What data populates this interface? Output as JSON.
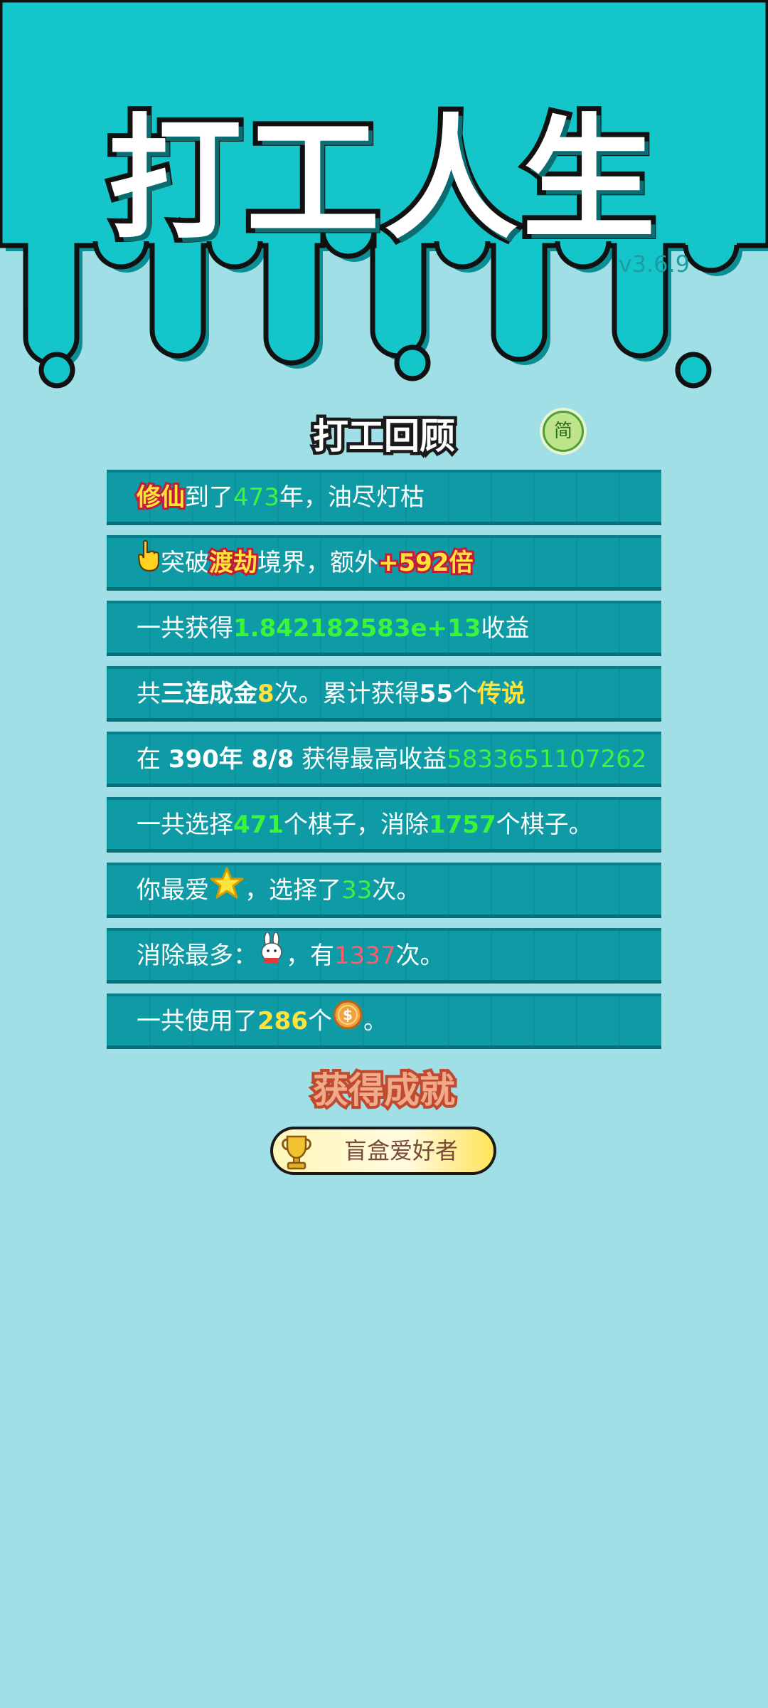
{
  "app": {
    "title": "打工人生",
    "version": "v3.6.9"
  },
  "review": {
    "title": "打工回顾",
    "lang_toggle": "简",
    "rows": [
      {
        "parts": [
          {
            "t": "修仙",
            "s": "hl"
          },
          {
            "t": "到了"
          },
          {
            "t": "473",
            "s": "g"
          },
          {
            "t": "年，油尽灯枯"
          }
        ]
      },
      {
        "icon": "hand-pointer-icon",
        "parts": [
          {
            "t": "突破"
          },
          {
            "t": "渡劫",
            "s": "hl"
          },
          {
            "t": "境界，额外"
          },
          {
            "t": "+592倍",
            "s": "hl"
          }
        ]
      },
      {
        "parts": [
          {
            "t": "一共获得"
          },
          {
            "t": "1.842182583e+13",
            "s": "g b"
          },
          {
            "t": "收益"
          }
        ]
      },
      {
        "parts": [
          {
            "t": "共"
          },
          {
            "t": "三连成金",
            "s": "b"
          },
          {
            "t": "8",
            "s": "y b"
          },
          {
            "t": "次。累计获得"
          },
          {
            "t": "55",
            "s": "b"
          },
          {
            "t": "个"
          },
          {
            "t": "传说",
            "s": "y b"
          }
        ]
      },
      {
        "parts": [
          {
            "t": "在 "
          },
          {
            "t": "390年 8/8",
            "s": "b"
          },
          {
            "t": " 获得最高收益"
          },
          {
            "t": "5833651107262",
            "s": "g"
          }
        ]
      },
      {
        "parts": [
          {
            "t": "一共选择"
          },
          {
            "t": "471",
            "s": "g b"
          },
          {
            "t": "个棋子，消除"
          },
          {
            "t": "1757",
            "s": "g b"
          },
          {
            "t": "个棋子。"
          }
        ]
      },
      {
        "parts": [
          {
            "t": "你最爱"
          },
          {
            "icon": "star-icon"
          },
          {
            "t": "，选择了"
          },
          {
            "t": "33",
            "s": "g"
          },
          {
            "t": "次。"
          }
        ]
      },
      {
        "parts": [
          {
            "t": "消除最多："
          },
          {
            "icon": "rabbit-icon"
          },
          {
            "t": "，有"
          },
          {
            "t": "1337",
            "s": "r"
          },
          {
            "t": "次。"
          }
        ]
      },
      {
        "parts": [
          {
            "t": "一共使用了"
          },
          {
            "t": "286",
            "s": "y b"
          },
          {
            "t": "个"
          },
          {
            "icon": "coin-icon"
          },
          {
            "t": "。"
          }
        ]
      }
    ]
  },
  "achievements": {
    "title": "获得成就",
    "items": [
      {
        "label": "盲盒爱好者",
        "icon": "trophy-icon"
      }
    ]
  },
  "colors": {
    "bg_top": "#14c6c9",
    "bg_bottom": "#a1dfe6",
    "row_bg": "#0e9ba6",
    "green": "#3af53a",
    "yellow": "#ffe23a",
    "red": "#ff5b6b"
  }
}
